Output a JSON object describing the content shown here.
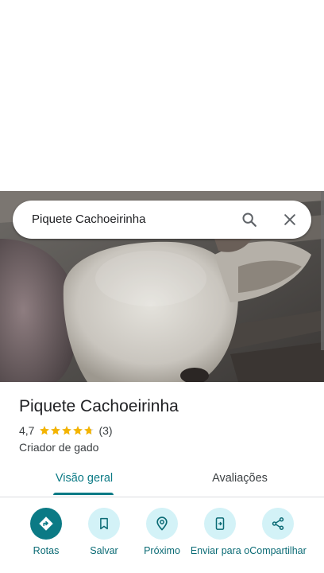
{
  "search": {
    "query": "Piquete Cachoeirinha"
  },
  "place": {
    "name": "Piquete Cachoeirinha",
    "rating": "4,7",
    "stars": 4.7,
    "review_count": "(3)",
    "category": "Criador de gado"
  },
  "tabs": [
    {
      "label": "Visão geral",
      "active": true
    },
    {
      "label": "Avaliações",
      "active": false
    }
  ],
  "actions": [
    {
      "label": "Rotas",
      "icon": "directions-icon"
    },
    {
      "label": "Salvar",
      "icon": "bookmark-icon"
    },
    {
      "label": "Próximo",
      "icon": "nearby-icon"
    },
    {
      "label": "Enviar para o",
      "icon": "send-to-phone-icon"
    },
    {
      "label": "Compartilhar",
      "icon": "share-icon"
    }
  ],
  "colors": {
    "accent": "#0b7a85",
    "action_bg": "#d3f2f7",
    "star": "#f4b400"
  }
}
